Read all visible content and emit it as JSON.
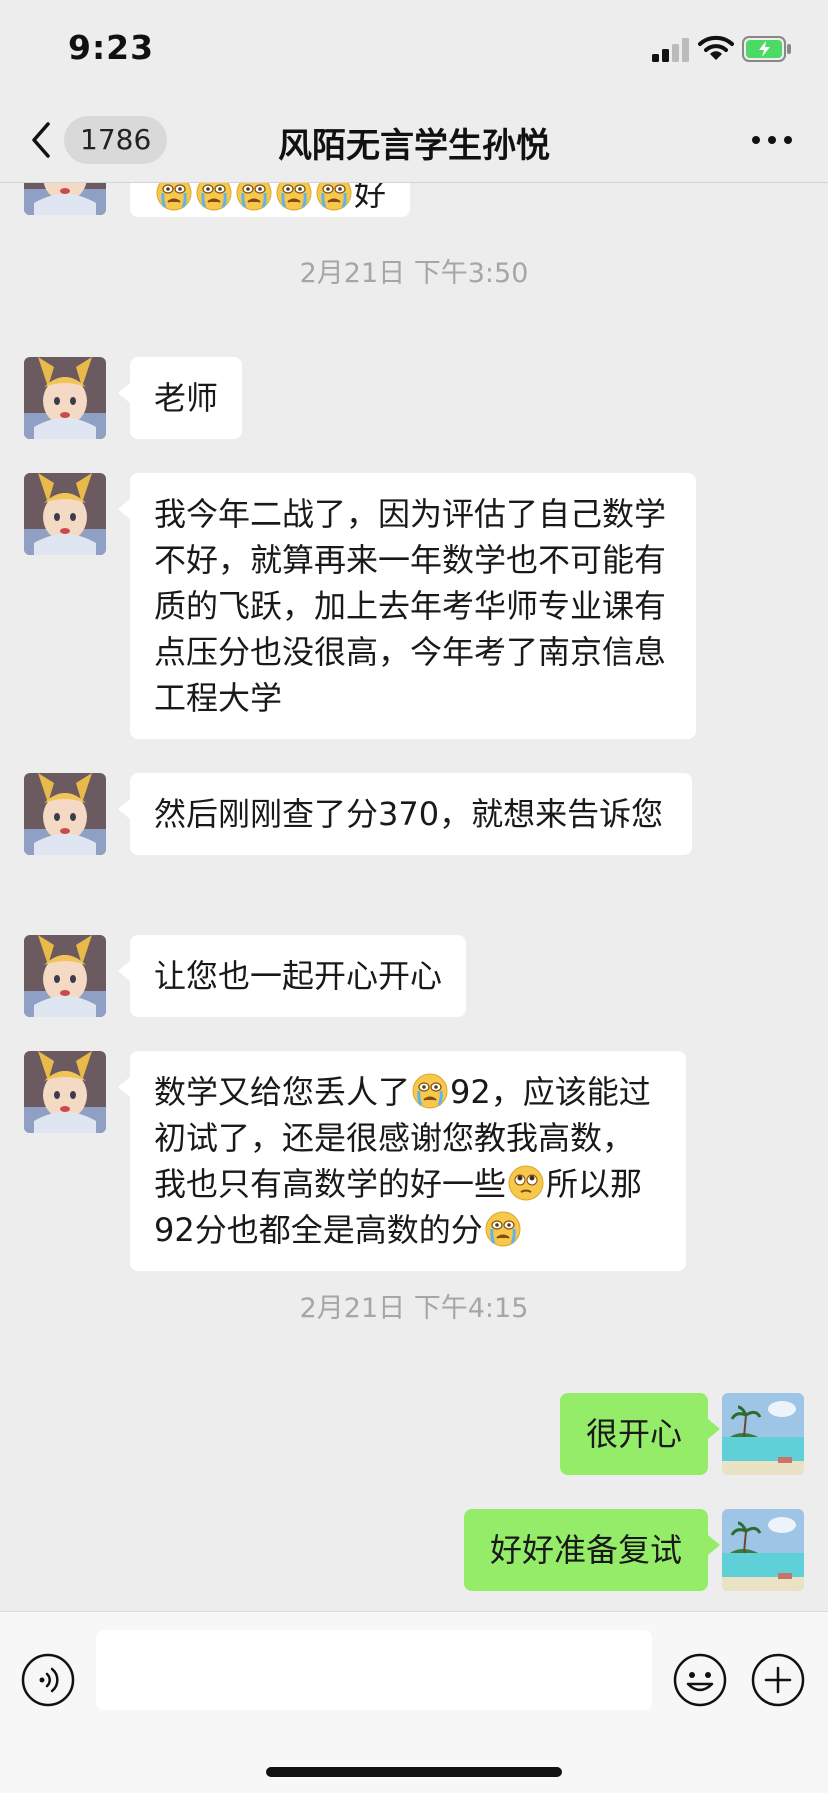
{
  "status_bar": {
    "time": "9:23"
  },
  "header": {
    "back_count": "1786",
    "title": "风陌无言学生孙悦"
  },
  "messages": [
    {
      "text": "好",
      "emoji_count": 5
    },
    {
      "timestamp": "2月21日 下午3:50"
    },
    {
      "text": "老师"
    },
    {
      "text": "我今年二战了，因为评估了自己数学不好，就算再来一年数学也不可能有质的飞跃，加上去年考华师专业课有点压分也没很高，今年考了南京信息工程大学"
    },
    {
      "text": "然后刚刚查了分370，就想来告诉您"
    },
    {
      "text": "让您也一起开心开心"
    },
    {
      "parts": [
        "数学又给您丢人了",
        "92，应该能过初试了，还是很感谢您教我高数，我也只有高数学的好一些",
        "所以那92分也都全是高数的分"
      ]
    },
    {
      "timestamp": "2月21日 下午4:15"
    },
    {
      "text": "很开心"
    },
    {
      "text": "好好准备复试"
    }
  ],
  "input": {
    "value": ""
  },
  "icons": {
    "back": "chevron-left-icon",
    "more": "more-icon",
    "voice": "voice-icon",
    "emoji": "emoji-icon",
    "plus": "plus-icon",
    "crying_emoji": "crying-emoji-icon",
    "pleading_emoji": "pleading-emoji-icon"
  },
  "colors": {
    "outgoing_bubble": "#95ec69",
    "incoming_bubble": "#ffffff",
    "background": "#ededed"
  }
}
